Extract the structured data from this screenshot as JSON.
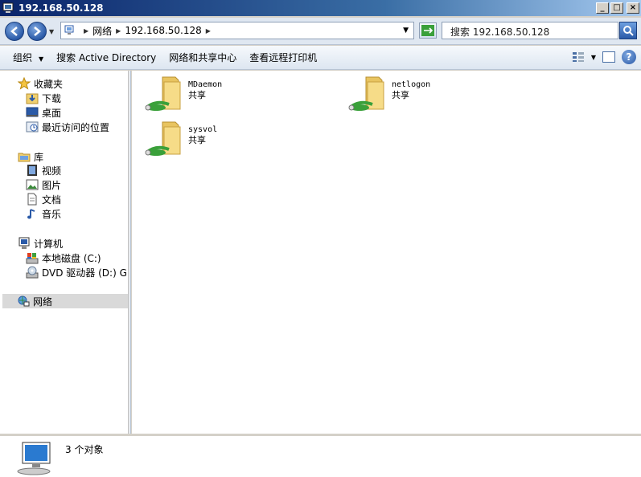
{
  "window": {
    "title": "192.168.50.128",
    "buttons": {
      "minimize": "_",
      "maximize": "□",
      "close": "×"
    }
  },
  "address_bar": {
    "crumbs": [
      "网络",
      "192.168.50.128"
    ],
    "search_placeholder": "搜索 192.168.50.128"
  },
  "toolbar": {
    "organize": "组织",
    "search_ad": "搜索 Active Directory",
    "network_center": "网络和共享中心",
    "view_printers": "查看远程打印机"
  },
  "nav": {
    "favorites": {
      "label": "收藏夹",
      "items": [
        "下载",
        "桌面",
        "最近访问的位置"
      ]
    },
    "libraries": {
      "label": "库",
      "items": [
        "视频",
        "图片",
        "文档",
        "音乐"
      ]
    },
    "computer": {
      "label": "计算机",
      "items": [
        "本地磁盘 (C:)",
        "DVD 驱动器 (D:) GF"
      ]
    },
    "network": {
      "label": "网络"
    }
  },
  "files": [
    {
      "name": "MDaemon",
      "desc": "共享"
    },
    {
      "name": "netlogon",
      "desc": "共享"
    },
    {
      "name": "sysvol",
      "desc": "共享"
    }
  ],
  "status": {
    "count": "3 个对象"
  }
}
